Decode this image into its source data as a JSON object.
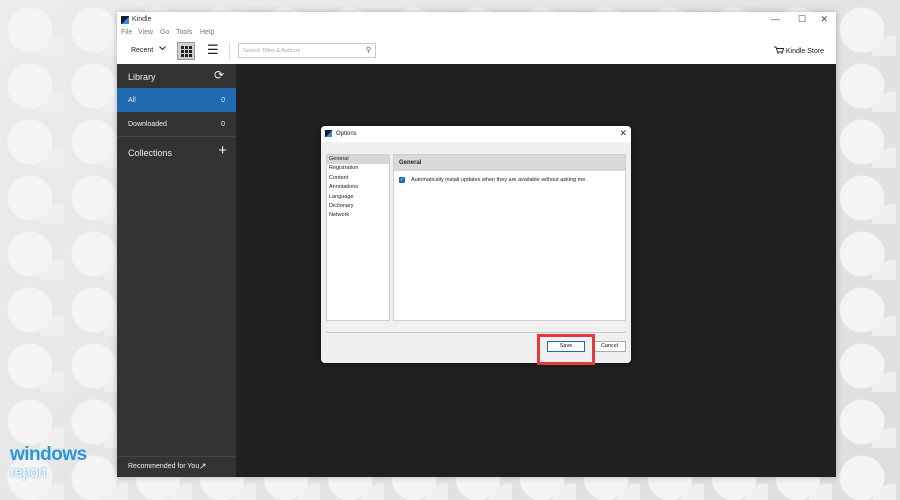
{
  "window": {
    "title": "Kindle",
    "minimize": "—",
    "maximize": "☐",
    "close": "✕"
  },
  "menu": [
    "File",
    "View",
    "Go",
    "Tools",
    "Help"
  ],
  "toolbar": {
    "sort_label": "Recent",
    "sort_icon": "chevron-down-icon",
    "search_placeholder": "Search Titles & Authors",
    "store_label": "Kindle Store"
  },
  "sidebar": {
    "library_label": "Library",
    "items": [
      {
        "label": "All",
        "count": "0",
        "active": true
      },
      {
        "label": "Downloaded",
        "count": "0",
        "active": false
      }
    ],
    "collections_label": "Collections",
    "recommended_label": "Recommended for You"
  },
  "dialog": {
    "title": "Options",
    "nav": [
      "General",
      "Registration",
      "Content",
      "Annotations",
      "Language",
      "Dictionary",
      "Network"
    ],
    "selected": "General",
    "panel_title": "General",
    "checkbox_label": "Automatically install updates when they are available without asking me.",
    "checkbox_checked": true,
    "save_label": "Save",
    "cancel_label": "Cancel"
  },
  "watermark": {
    "line1": "windows",
    "line2": "report"
  },
  "colors": {
    "accent": "#1f6ab0",
    "highlight": "#e53a3a",
    "sidebar": "#333333",
    "content": "#202020"
  }
}
